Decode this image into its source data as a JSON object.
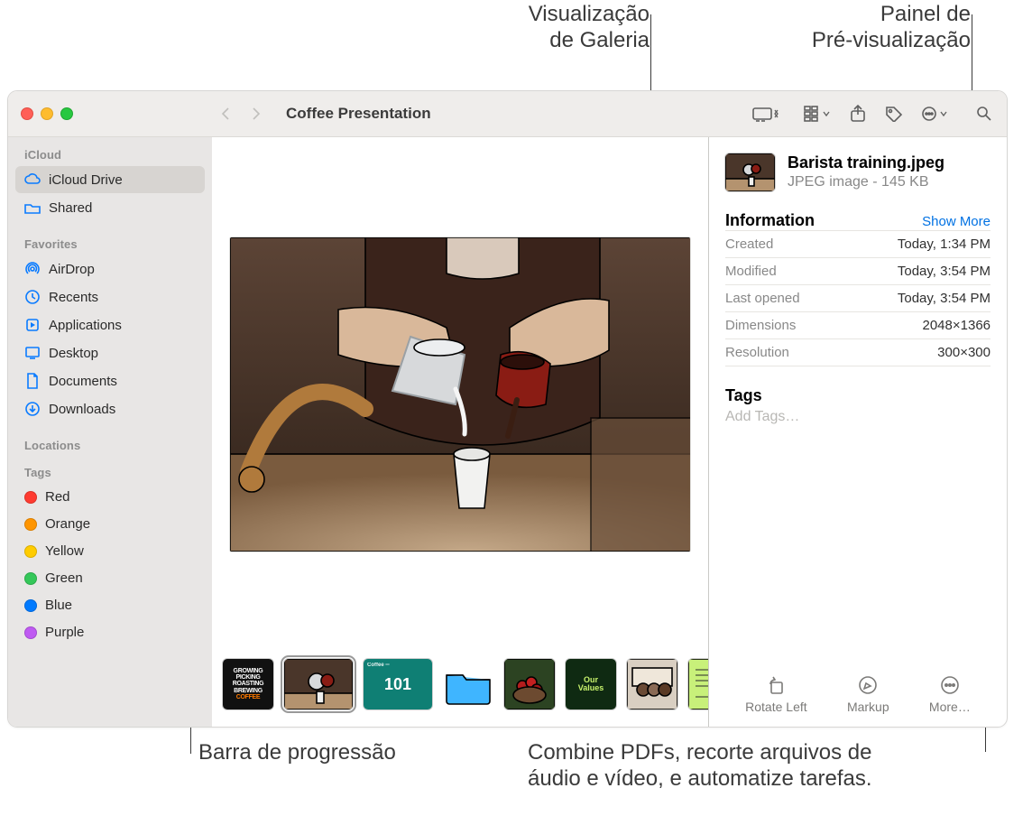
{
  "callouts": {
    "gallery_view": "Visualização\nde Galeria",
    "preview_pane": "Painel de\nPré-visualização",
    "scrub_bar": "Barra de progressão",
    "more_hint": "Combine PDFs, recorte arquivos de\náudio e vídeo, e automatize tarefas."
  },
  "window": {
    "title": "Coffee Presentation"
  },
  "sidebar": {
    "sections": {
      "icloud": "iCloud",
      "favorites": "Favorites",
      "locations": "Locations",
      "tags": "Tags"
    },
    "icloud": [
      {
        "label": "iCloud Drive",
        "icon": "cloud-icon",
        "selected": true
      },
      {
        "label": "Shared",
        "icon": "shared-folder-icon"
      }
    ],
    "favorites": [
      {
        "label": "AirDrop",
        "icon": "airdrop-icon"
      },
      {
        "label": "Recents",
        "icon": "recents-icon"
      },
      {
        "label": "Applications",
        "icon": "applications-icon"
      },
      {
        "label": "Desktop",
        "icon": "desktop-icon"
      },
      {
        "label": "Documents",
        "icon": "documents-icon"
      },
      {
        "label": "Downloads",
        "icon": "downloads-icon"
      }
    ],
    "tags": [
      {
        "label": "Red",
        "color": "#ff3b30"
      },
      {
        "label": "Orange",
        "color": "#ff9500"
      },
      {
        "label": "Yellow",
        "color": "#ffcc00"
      },
      {
        "label": "Green",
        "color": "#34c759"
      },
      {
        "label": "Blue",
        "color": "#007aff"
      },
      {
        "label": "Purple",
        "color": "#bf5af2"
      }
    ]
  },
  "preview": {
    "filename": "Barista training.jpeg",
    "filetype": "JPEG image - 145 KB",
    "section_info": "Information",
    "show_more": "Show More",
    "kv": [
      {
        "k": "Created",
        "v": "Today, 1:34 PM"
      },
      {
        "k": "Modified",
        "v": "Today, 3:54 PM"
      },
      {
        "k": "Last opened",
        "v": "Today, 3:54 PM"
      },
      {
        "k": "Dimensions",
        "v": "2048×1366"
      },
      {
        "k": "Resolution",
        "v": "300×300"
      }
    ],
    "section_tags": "Tags",
    "add_tags": "Add Tags…",
    "actions": {
      "rotate": "Rotate Left",
      "markup": "Markup",
      "more": "More…"
    }
  },
  "thumbs": [
    {
      "id": "growing-picking",
      "text": "GROWING\nPICKING\nROASTING\nBREWING",
      "bg": "#111",
      "fg": "#fff",
      "accent": "#ff7a00"
    },
    {
      "id": "barista",
      "selected": true
    },
    {
      "id": "coffee-101",
      "text": "101",
      "bg": "#0f7f74",
      "fg": "#fff"
    },
    {
      "id": "folder",
      "folder": true
    },
    {
      "id": "cherries"
    },
    {
      "id": "our-values",
      "text": "Our\nValues",
      "bg": "#0f2a12",
      "fg": "#c7f26c"
    },
    {
      "id": "team"
    },
    {
      "id": "note",
      "bg": "#c8f07a"
    }
  ]
}
